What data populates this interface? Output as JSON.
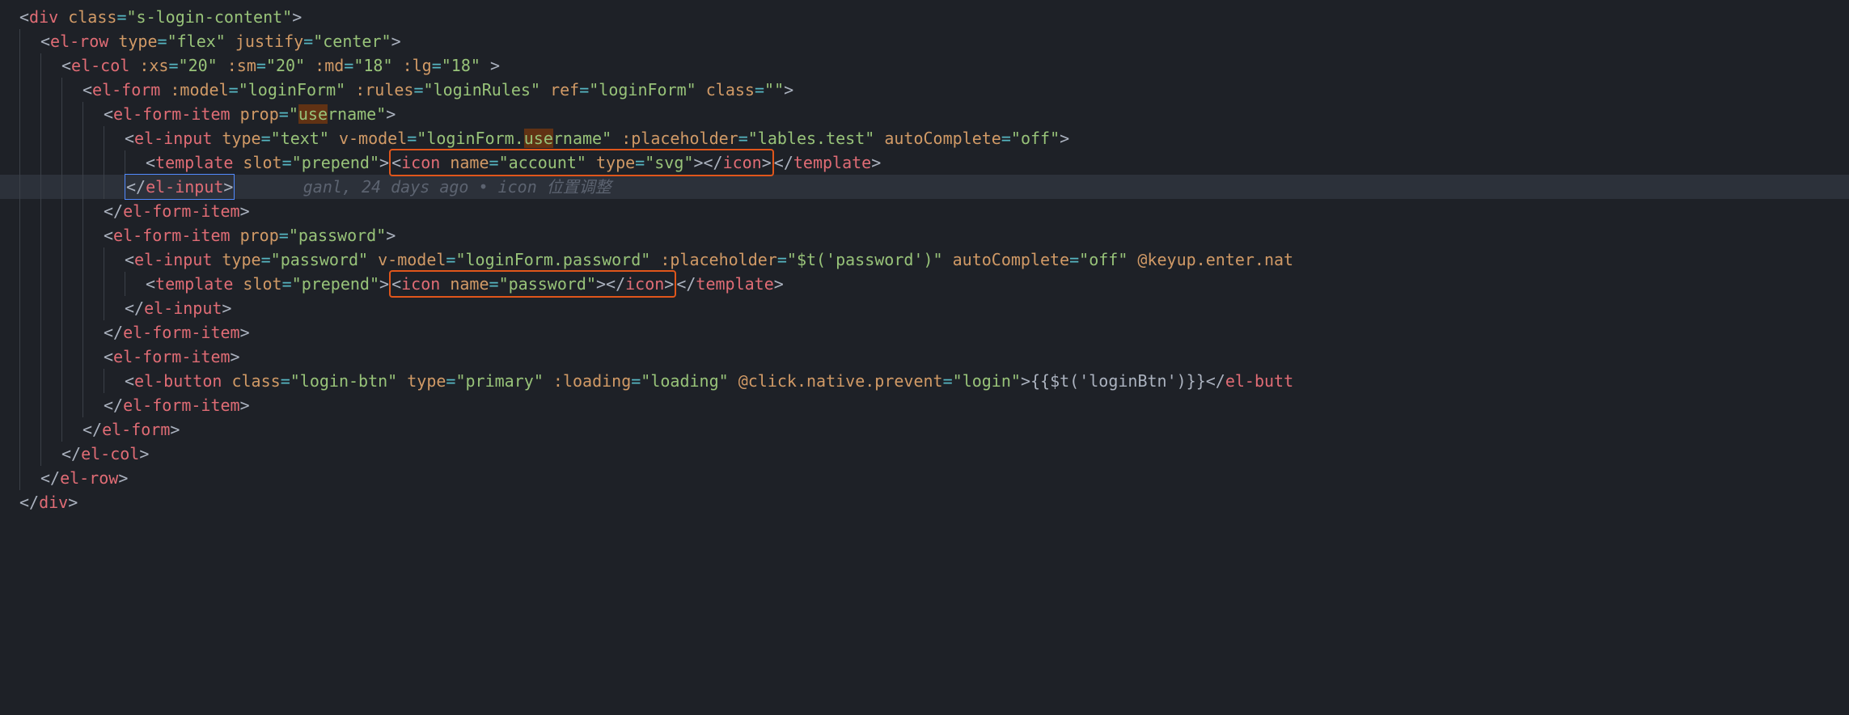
{
  "lines": {
    "l1": {
      "div": "div",
      "classAttr": "class",
      "classVal": "s-login-content"
    },
    "l2": {
      "tag": "el-row",
      "typeAttr": "type",
      "typeVal": "flex",
      "justifyAttr": "justify",
      "justifyVal": "center"
    },
    "l3": {
      "tag": "el-col",
      "xsAttr": ":xs",
      "xsVal": "20",
      "smAttr": ":sm",
      "smVal": "20",
      "mdAttr": ":md",
      "mdVal": "18",
      "lgAttr": ":lg",
      "lgVal": "18"
    },
    "l4": {
      "tag": "el-form",
      "modelAttr": ":model",
      "modelVal": "loginForm",
      "rulesAttr": ":rules",
      "rulesVal": "loginRules",
      "refAttr": "ref",
      "refVal": "loginForm",
      "classAttr": "class",
      "classVal": ""
    },
    "l5": {
      "tag": "el-form-item",
      "propAttr": "prop",
      "propVal1": "use",
      "propVal2": "rname"
    },
    "l6": {
      "tag": "el-input",
      "typeAttr": "type",
      "typeVal": "text",
      "vmodelAttr": "v-model",
      "vmodelVal1": "loginForm.",
      "vmodelVal2": "use",
      "vmodelVal3": "rname",
      "phAttr": ":placeholder",
      "phVal": "lables.test",
      "acAttr": "autoComplete",
      "acVal": "off"
    },
    "l7": {
      "tmpl": "template",
      "slotAttr": "slot",
      "slotVal": "prepend",
      "icon": "icon",
      "nameAttr": "name",
      "nameVal": "account",
      "typeAttr": "type",
      "typeVal": "svg",
      "closeTmpl": "template"
    },
    "l8": {
      "closeInput": "el-input",
      "blame": "ganl, 24 days ago • icon 位置调整"
    },
    "l9": {
      "closeItem": "el-form-item"
    },
    "l10": {
      "tag": "el-form-item",
      "propAttr": "prop",
      "propVal": "password"
    },
    "l11": {
      "tag": "el-input",
      "typeAttr": "type",
      "typeVal": "password",
      "vmodelAttr": "v-model",
      "vmodelVal": "loginForm.password",
      "phAttr": ":placeholder",
      "phVal": "$t('password')",
      "acAttr": "autoComplete",
      "acVal": "off",
      "keyAttr": "@keyup.enter.nat"
    },
    "l12": {
      "tmpl": "template",
      "slotAttr": "slot",
      "slotVal": "prepend",
      "icon": "icon",
      "nameAttr": "name",
      "nameVal": "password",
      "closeTmpl": "template"
    },
    "l13": {
      "closeInput": "el-input"
    },
    "l14": {
      "closeItem": "el-form-item"
    },
    "l15": {
      "tag": "el-form-item"
    },
    "l16": {
      "tag": "el-button",
      "classAttr": "class",
      "classVal": "login-btn",
      "typeAttr": "type",
      "typeVal": "primary",
      "loadAttr": ":loading",
      "loadVal": "loading",
      "clickAttr": "@click.native.prevent",
      "clickVal": "login",
      "text": "{{$t('loginBtn')}}",
      "closeBtn": "el-butt"
    },
    "l17": {
      "closeItem": "el-form-item"
    },
    "l18": {
      "closeForm": "el-form"
    },
    "l19": {
      "closeCol": "el-col"
    },
    "l20": {
      "closeRow": "el-row"
    },
    "l21": {
      "closeDiv": "div"
    }
  }
}
